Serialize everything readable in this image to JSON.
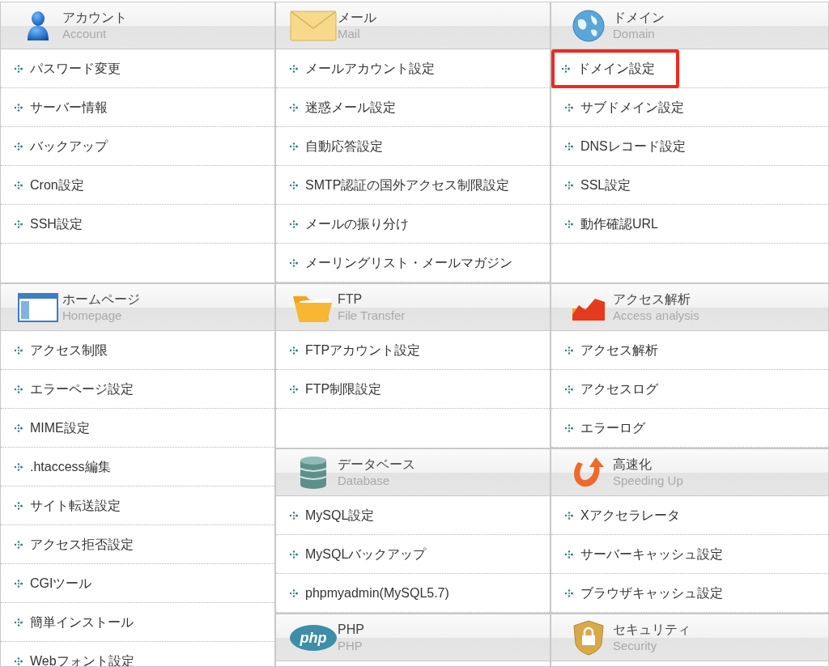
{
  "sections": [
    {
      "kind": "account",
      "title": "アカウント",
      "subtitle": "Account",
      "items": [
        {
          "label": "パスワード変更",
          "highlighted": false
        },
        {
          "label": "サーバー情報",
          "highlighted": false
        },
        {
          "label": "バックアップ",
          "highlighted": false
        },
        {
          "label": "Cron設定",
          "highlighted": false
        },
        {
          "label": "SSH設定",
          "highlighted": false
        }
      ]
    },
    {
      "kind": "mail",
      "title": "メール",
      "subtitle": "Mail",
      "items": [
        {
          "label": "メールアカウント設定",
          "highlighted": false
        },
        {
          "label": "迷惑メール設定",
          "highlighted": false
        },
        {
          "label": "自動応答設定",
          "highlighted": false
        },
        {
          "label": "SMTP認証の国外アクセス制限設定",
          "highlighted": false
        },
        {
          "label": "メールの振り分け",
          "highlighted": false
        },
        {
          "label": "メーリングリスト・メールマガジン",
          "highlighted": false
        }
      ]
    },
    {
      "kind": "domain",
      "title": "ドメイン",
      "subtitle": "Domain",
      "items": [
        {
          "label": "ドメイン設定",
          "highlighted": true
        },
        {
          "label": "サブドメイン設定",
          "highlighted": false
        },
        {
          "label": "DNSレコード設定",
          "highlighted": false
        },
        {
          "label": "SSL設定",
          "highlighted": false
        },
        {
          "label": "動作確認URL",
          "highlighted": false
        }
      ]
    },
    {
      "kind": "homepage",
      "title": "ホームページ",
      "subtitle": "Homepage",
      "items": [
        {
          "label": "アクセス制限",
          "highlighted": false
        },
        {
          "label": "エラーページ設定",
          "highlighted": false
        },
        {
          "label": "MIME設定",
          "highlighted": false
        },
        {
          "label": ".htaccess編集",
          "highlighted": false
        },
        {
          "label": "サイト転送設定",
          "highlighted": false
        },
        {
          "label": "アクセス拒否設定",
          "highlighted": false
        },
        {
          "label": "CGIツール",
          "highlighted": false
        },
        {
          "label": "簡単インストール",
          "highlighted": false
        },
        {
          "label": "Webフォント設定",
          "highlighted": false
        }
      ]
    },
    {
      "kind": "ftp",
      "title": "FTP",
      "subtitle": "File Transfer",
      "items": [
        {
          "label": "FTPアカウント設定",
          "highlighted": false
        },
        {
          "label": "FTP制限設定",
          "highlighted": false
        }
      ]
    },
    {
      "kind": "analytics",
      "title": "アクセス解析",
      "subtitle": "Access analysis",
      "items": [
        {
          "label": "アクセス解析",
          "highlighted": false
        },
        {
          "label": "アクセスログ",
          "highlighted": false
        },
        {
          "label": "エラーログ",
          "highlighted": false
        }
      ]
    },
    {
      "kind": "database",
      "title": "データベース",
      "subtitle": "Database",
      "items": [
        {
          "label": "MySQL設定",
          "highlighted": false
        },
        {
          "label": "MySQLバックアップ",
          "highlighted": false
        },
        {
          "label": "phpmyadmin(MySQL5.7)",
          "highlighted": false
        }
      ]
    },
    {
      "kind": "speed",
      "title": "高速化",
      "subtitle": "Speeding Up",
      "items": [
        {
          "label": "Xアクセラレータ",
          "highlighted": false
        },
        {
          "label": "サーバーキャッシュ設定",
          "highlighted": false
        },
        {
          "label": "ブラウザキャッシュ設定",
          "highlighted": false
        }
      ]
    },
    {
      "kind": "php",
      "title": "PHP",
      "subtitle": "PHP",
      "logo_text": "php"
    },
    {
      "kind": "security",
      "title": "セキュリティ",
      "subtitle": "Security"
    }
  ]
}
